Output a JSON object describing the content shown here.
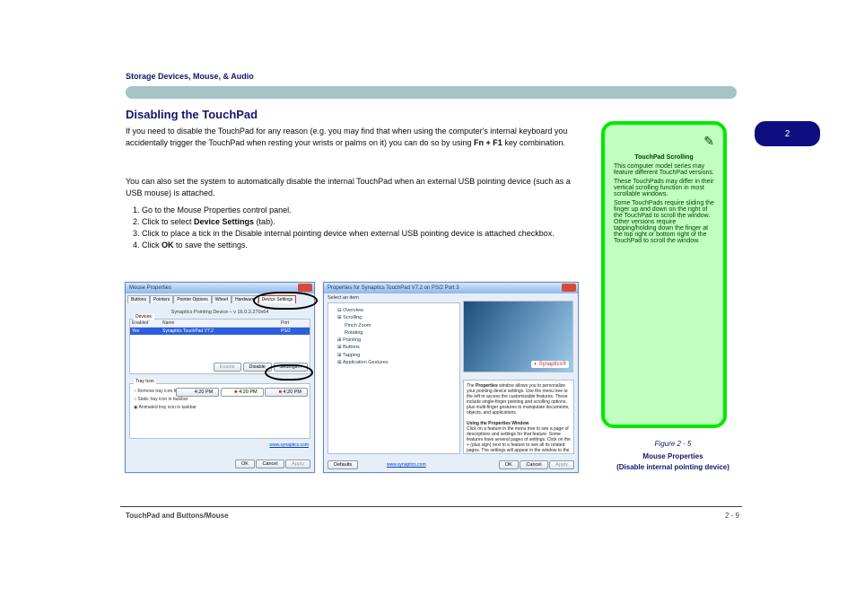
{
  "header": {
    "section_number": "2",
    "section_title": "TouchPad and Buttons/Mouse",
    "page_title": "Storage Devices, Mouse, & Audio"
  },
  "sidebar_tab": "2",
  "body": {
    "heading": "Disabling the TouchPad",
    "para1_lead": "If you need to disable the TouchPad for any reason (e.g. you may find that when using the computer's internal keyboard you accidentally trigger the TouchPad when resting your wrists or palms on it) you can do so by using ",
    "para1_key": "Fn + F1",
    "para1_tail": " key combination.",
    "para2_lead": "You can also set the system to automatically disable the internal TouchPad when an external USB pointing device (such as a USB mouse) is attached.",
    "steps": {
      "1": "Go to the Mouse Properties control panel.",
      "2": "Click to select Device Settings (tab).",
      "3": "Click to place a tick in the Disable internal pointing device when external USB pointing device is attached checkbox.",
      "4": "Click OK to save the settings."
    }
  },
  "window_left": {
    "title": "Mouse Properties",
    "tabs": [
      "Buttons",
      "Pointers",
      "Pointer Options",
      "Wheel",
      "Hardware",
      "Device Settings"
    ],
    "device_line": "Synaptics Pointing Device – v 16.0.3.270x64",
    "devices_label": "Devices:",
    "cols": {
      "c1": "Enabled",
      "c2": "Name",
      "c3": "Port"
    },
    "row": {
      "c1": "Yes",
      "c2": "Synaptics TouchPad V7.2",
      "c3": "PS/2"
    },
    "btns": {
      "enable": "Enable",
      "disable": "Disable",
      "settings": "Settings..."
    },
    "tray_label": "Tray Icon",
    "opt1": "Remove tray icon from taskbar",
    "opt2": "Static tray icon in taskbar",
    "opt3": "Animated tray icon in taskbar",
    "time": "4:20 PM",
    "link": "www.synaptics.com",
    "bottom": {
      "ok": "OK",
      "cancel": "Cancel",
      "apply": "Apply"
    }
  },
  "window_right": {
    "title": "Properties for Synaptics TouchPad V7.2 on PS/2 Port 3",
    "select_label": "Select an item",
    "tree": {
      "t1": "Overview",
      "t2": "Scrolling",
      "t2a": "Pinch Zoom",
      "t2b": "Rotating",
      "t3": "Pointing",
      "t4": "Buttons",
      "t5": "Tapping",
      "t6": "Application Gestures"
    },
    "logo": "Synaptics",
    "desc_p1_lead": "The ",
    "desc_b1": "Properties",
    "desc_p1_tail": " window allows you to personalize your pointing device settings. Use the menu tree to the left to access the customizable features. These include single-finger pointing and scrolling options, plus multi-finger gestures to manipulate documents, objects, and applications.",
    "desc_h": "Using the Properties Window",
    "desc_p2": "Click on a feature in the menu tree to see a page of descriptions and settings for that feature. Some features have several pages of settings. Click on the + (plus sign) next to a feature to see all its related pages. The settings will appear in the window to the right of the menu tree. Information about these options and instructions on how to change them will appear here in this information box. You can use the scroll bar to view the",
    "bottom": {
      "defaults": "Defaults",
      "link": "www.synaptics.com",
      "ok": "OK",
      "cancel": "Cancel",
      "apply": "Apply"
    }
  },
  "note": {
    "h": "TouchPad Scrolling",
    "p1": "This computer model series may feature different TouchPad versions.",
    "p2": "These TouchPads may differ in their vertical scrolling function in most scrollable windows.",
    "p3": "Some TouchPads require sliding the finger up and down on the right of the TouchPad to scroll the window. Other versions require tapping/holding down the finger at the top right or bottom right of the TouchPad to scroll the window."
  },
  "figure": {
    "label": "Figure 2 - 5",
    "cap1": "Mouse Properties",
    "cap2": "(Disable internal pointing device)"
  },
  "footer": {
    "left": "TouchPad and Buttons/Mouse",
    "right": "2 - 9"
  }
}
